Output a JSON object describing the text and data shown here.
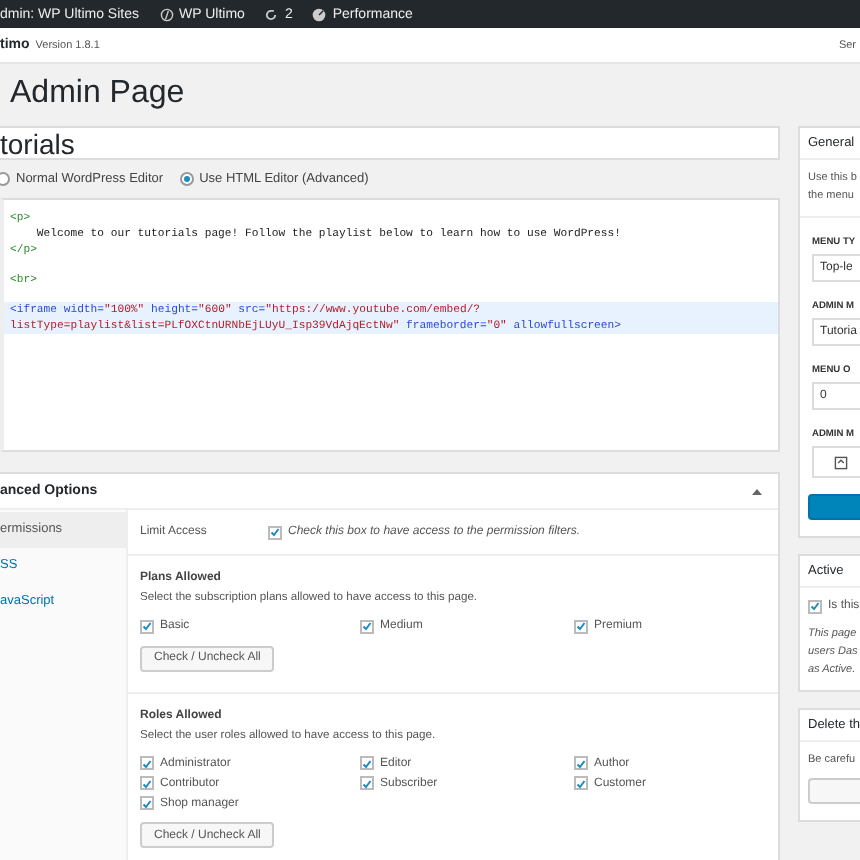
{
  "admin_bar": [
    {
      "kind": "sites",
      "label": "dmin: WP Ultimo Sites"
    },
    {
      "kind": "brand",
      "label": "WP Ultimo"
    },
    {
      "kind": "updates",
      "label": "2"
    },
    {
      "kind": "performance",
      "label": "Performance"
    }
  ],
  "header": {
    "plugin": "timo",
    "version": "Version 1.8.1",
    "right": "Ser"
  },
  "page_title": "Admin Page",
  "title_field": {
    "value": "torials"
  },
  "editor_modes": [
    {
      "label": "Normal WordPress Editor",
      "selected": false
    },
    {
      "label": "Use HTML Editor (Advanced)",
      "selected": true
    }
  ],
  "code_lines": [
    {
      "kind": "code",
      "highlighted": false,
      "tokens": [
        {
          "kind": "tag",
          "text": "<p>"
        }
      ]
    },
    {
      "kind": "code",
      "highlighted": false,
      "tokens": [
        {
          "kind": "text",
          "text": "    Welcome to our tutorials page! Follow the playlist below to learn how to use WordPress!"
        }
      ]
    },
    {
      "kind": "code",
      "highlighted": false,
      "tokens": [
        {
          "kind": "tag",
          "text": "</p>"
        }
      ]
    },
    {
      "kind": "blank"
    },
    {
      "kind": "code",
      "highlighted": false,
      "tokens": [
        {
          "kind": "tag",
          "text": "<br>"
        }
      ]
    },
    {
      "kind": "blank"
    },
    {
      "kind": "code",
      "highlighted": true,
      "tokens": [
        {
          "kind": "element",
          "text": "<iframe"
        },
        {
          "kind": "attr",
          "text": " width="
        },
        {
          "kind": "value",
          "text": "\"100%\""
        },
        {
          "kind": "attr",
          "text": " height="
        },
        {
          "kind": "value",
          "text": "\"600\""
        },
        {
          "kind": "attr",
          "text": " src="
        },
        {
          "kind": "value",
          "text": "\"https://www.youtube.com/embed/?"
        }
      ]
    },
    {
      "kind": "code",
      "highlighted": true,
      "tokens": [
        {
          "kind": "value",
          "text": "listType=playlist&list=PLfOXCtnURNbEjLUyU_Isp39VdAjqEctNw\""
        },
        {
          "kind": "attr",
          "text": " frameborder="
        },
        {
          "kind": "value",
          "text": "\"0\""
        },
        {
          "kind": "attr",
          "text": " allowfullscreen"
        },
        {
          "kind": "element",
          "text": ">"
        }
      ]
    }
  ],
  "advanced": {
    "title": "anced Options",
    "tabs": [
      {
        "label": "ermissions",
        "selected": true
      },
      {
        "label": "SS",
        "selected": false
      },
      {
        "label": "avaScript",
        "selected": false
      }
    ],
    "limit_access": {
      "label": "Limit Access",
      "checked": true,
      "description": "Check this box to have access to the permission filters."
    },
    "sections": [
      {
        "title": "Plans Allowed",
        "description": "Select the subscription plans allowed to have access to this page.",
        "options": [
          {
            "label": "Basic",
            "checked": true
          },
          {
            "label": "Medium",
            "checked": true
          },
          {
            "label": "Premium",
            "checked": true
          }
        ],
        "button": "Check / Uncheck All"
      },
      {
        "title": "Roles Allowed",
        "description": "Select the user roles allowed to have access to this page.",
        "options": [
          {
            "label": "Administrator",
            "checked": true
          },
          {
            "label": "Editor",
            "checked": true
          },
          {
            "label": "Author",
            "checked": true
          },
          {
            "label": "Contributor",
            "checked": true
          },
          {
            "label": "Subscriber",
            "checked": true
          },
          {
            "label": "Customer",
            "checked": true
          },
          {
            "label": "Shop manager",
            "checked": true
          }
        ],
        "button": "Check / Uncheck All"
      }
    ]
  },
  "sidebar": {
    "general": {
      "title": "General",
      "intro": [
        "Use this b",
        "the menu"
      ],
      "fields": [
        {
          "kind": "select",
          "label": "MENU TY",
          "value": "Top-le"
        },
        {
          "kind": "text",
          "label": "ADMIN M",
          "value": "Tutoria"
        },
        {
          "kind": "text",
          "label": "MENU O",
          "value": "0"
        },
        {
          "kind": "icon",
          "label": "ADMIN M"
        }
      ]
    },
    "active": {
      "title": "Active",
      "checkbox": {
        "label": "Is this",
        "checked": true
      },
      "note": [
        "This page",
        "users Das",
        "as Active."
      ]
    },
    "delete": {
      "title": "Delete th",
      "text": "Be carefu"
    }
  }
}
